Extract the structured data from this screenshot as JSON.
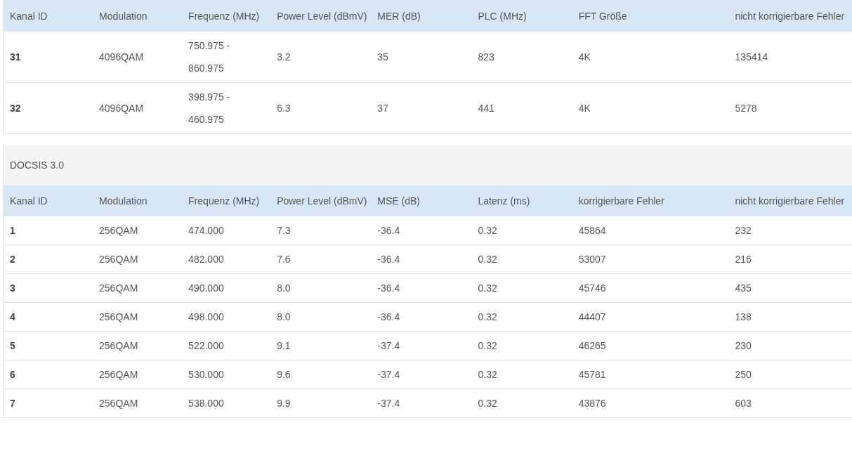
{
  "tables": [
    {
      "columns": [
        "Kanal ID",
        "Modulation",
        "Frequenz (MHz)",
        "Power Level (dBmV)",
        "MER (dB)",
        "PLC (MHz)",
        "FFT Größe",
        "nicht korrigierbare Fehler"
      ],
      "rows": [
        [
          "31",
          "4096QAM",
          "750.975 - 860.975",
          "3.2",
          "35",
          "823",
          "4K",
          "135414"
        ],
        [
          "32",
          "4096QAM",
          "398.975 - 460.975",
          "6.3",
          "37",
          "441",
          "4K",
          "5278"
        ]
      ]
    },
    {
      "title": "DOCSIS 3.0",
      "columns": [
        "Kanal ID",
        "Modulation",
        "Frequenz (MHz)",
        "Power Level (dBmV)",
        "MSE (dB)",
        "Latenz (ms)",
        "korrigierbare Fehler",
        "nicht korrigierbare Fehler"
      ],
      "rows": [
        [
          "1",
          "256QAM",
          "474.000",
          "7.3",
          "-36.4",
          "0.32",
          "45864",
          "232"
        ],
        [
          "2",
          "256QAM",
          "482.000",
          "7.6",
          "-36.4",
          "0.32",
          "53007",
          "216"
        ],
        [
          "3",
          "256QAM",
          "490.000",
          "8.0",
          "-36.4",
          "0.32",
          "45746",
          "435"
        ],
        [
          "4",
          "256QAM",
          "498.000",
          "8.0",
          "-36.4",
          "0.32",
          "44407",
          "138"
        ],
        [
          "5",
          "256QAM",
          "522.000",
          "9.1",
          "-37.4",
          "0.32",
          "46265",
          "230"
        ],
        [
          "6",
          "256QAM",
          "530.000",
          "9.6",
          "-37.4",
          "0.32",
          "45781",
          "250"
        ],
        [
          "7",
          "256QAM",
          "538.000",
          "9.9",
          "-37.4",
          "0.32",
          "43876",
          "603"
        ]
      ]
    }
  ]
}
